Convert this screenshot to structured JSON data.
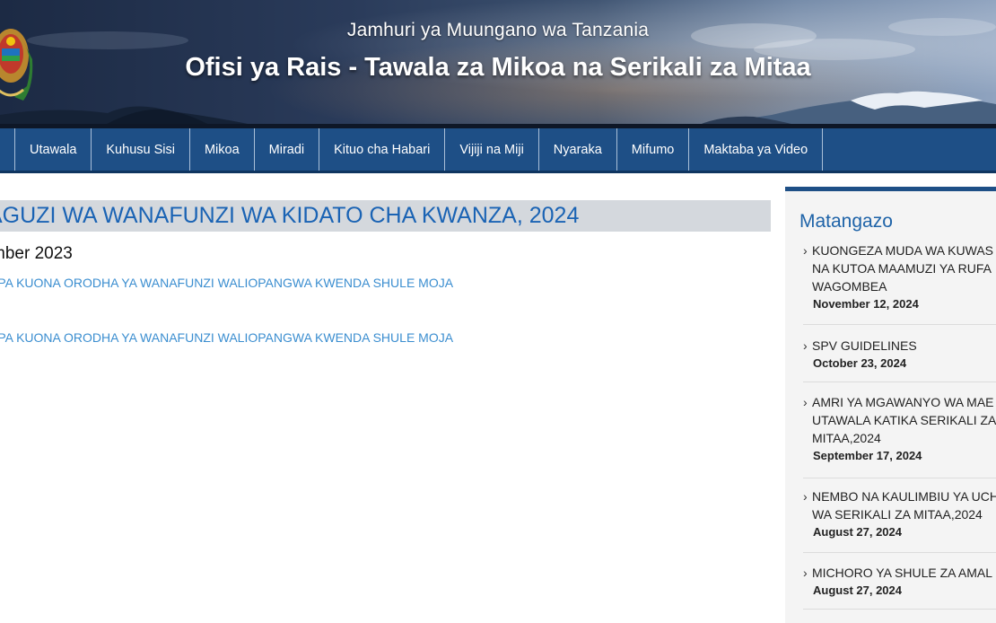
{
  "header": {
    "subtitle": "Jamhuri ya Muungano wa Tanzania",
    "title": "Ofisi ya Rais - Tawala za Mikoa na Serikali za Mitaa"
  },
  "nav": {
    "items": [
      "",
      "Utawala",
      "Kuhusu Sisi",
      "Mikoa",
      "Miradi",
      "Kituo cha Habari",
      "Vijiji na Miji",
      "Nyaraka",
      "Mifumo",
      "Maktaba ya Video"
    ]
  },
  "article": {
    "title": "AGUZI WA WANAFUNZI WA KIDATO CHA KWANZA, 2024",
    "date": "mber 2023",
    "links": [
      "APA KUONA ORODHA YA WANAFUNZI WALIOPANGWA KWENDA SHULE MOJA",
      "APA KUONA ORODHA YA WANAFUNZI WALIOPANGWA KWENDA SHULE MOJA"
    ]
  },
  "sidebar": {
    "heading": "Matangazo",
    "items": [
      {
        "lines": [
          "KUONGEZA MUDA WA KUWAS",
          "NA KUTOA MAAMUZI YA RUFA",
          "WAGOMBEA"
        ],
        "date": "November 12, 2024"
      },
      {
        "lines": [
          "SPV GUIDELINES"
        ],
        "date": "October 23, 2024"
      },
      {
        "lines": [
          "AMRI YA MGAWANYO WA MAE",
          "UTAWALA KATIKA SERIKALI ZA",
          "MITAA,2024"
        ],
        "date": "September 17, 2024"
      },
      {
        "lines": [
          "NEMBO NA KAULIMBIU YA UCH",
          "WA SERIKALI ZA MITAA,2024"
        ],
        "date": "August 27, 2024"
      },
      {
        "lines": [
          "MICHORO YA SHULE ZA AMAL"
        ],
        "date": "August 27, 2024"
      }
    ]
  },
  "colors": {
    "nav_bg": "#1e4f86",
    "headline": "#1a63b4",
    "link": "#3b8ed0",
    "sidebar_heading": "#1e63a8"
  }
}
